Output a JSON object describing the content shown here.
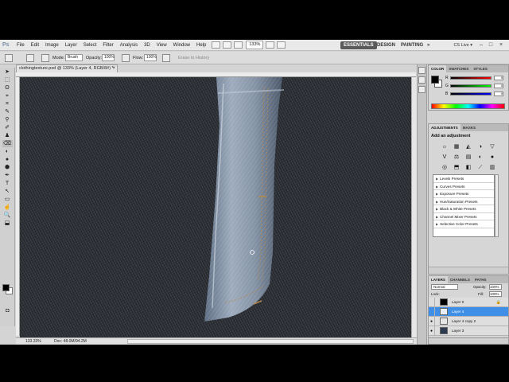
{
  "menubar": {
    "logo": "Ps",
    "items": [
      "File",
      "Edit",
      "Image",
      "Layer",
      "Select",
      "Filter",
      "Analysis",
      "3D",
      "View",
      "Window",
      "Help"
    ],
    "zoom": "133%",
    "workspaces": {
      "active": "ESSENTIALS",
      "others": [
        "DESIGN",
        "PAINTING"
      ],
      "more": "»"
    },
    "cslive": "CS Live ▾",
    "window_controls": [
      "–",
      "□",
      "×"
    ]
  },
  "options": {
    "mode_label": "Mode:",
    "mode_value": "Brush",
    "opacity_label": "Opacity:",
    "opacity_value": "100%",
    "flow_label": "Flow:",
    "flow_value": "100%",
    "erase_history": "Erase to History"
  },
  "document": {
    "tab_title": "clothingtexture.psd @ 133% (Layer 4, RGB/8#) *",
    "close": "×",
    "status_zoom": "133.33%",
    "status_doc": "Doc: 48.0M/94.2M"
  },
  "tools": {
    "glyphs": [
      "➤",
      "⬚",
      "ʘ",
      "⌖",
      "⌗",
      "✎",
      "⚲",
      "✐",
      "♟",
      "⌫",
      "◐",
      "●",
      "⬢",
      "✒",
      "T",
      "↖",
      "▭",
      "☝",
      "🔍",
      "⬓"
    ]
  },
  "color_panel": {
    "tabs": [
      "COLOR",
      "SWATCHES",
      "STYLES"
    ],
    "sliders": [
      {
        "label": "R",
        "value": "0"
      },
      {
        "label": "G",
        "value": "0"
      },
      {
        "label": "B",
        "value": "0"
      }
    ]
  },
  "adjustments": {
    "tabs": [
      "ADJUSTMENTS",
      "MASKS"
    ],
    "title": "Add an adjustment",
    "icons": [
      "☼",
      "▦",
      "◭",
      "◑",
      "▽",
      "V",
      "⚖",
      "▤",
      "◐",
      "●",
      "◎",
      "⬒",
      "◧",
      "⟋",
      "▥"
    ],
    "presets": [
      "Levels Presets",
      "Curves Presets",
      "Exposure Presets",
      "Hue/Saturation Presets",
      "Black & White Presets",
      "Channel Mixer Presets",
      "Selective Color Presets"
    ]
  },
  "layers": {
    "tabs": [
      "LAYERS",
      "CHANNELS",
      "PATHS"
    ],
    "blend_mode": "Normal",
    "opacity_label": "Opacity:",
    "opacity": "100%",
    "lock_label": "Lock:",
    "fill_label": "Fill:",
    "fill": "100%",
    "items": [
      {
        "name": "Layer 0"
      },
      {
        "name": "Layer 4"
      },
      {
        "name": "Layer 4 copy 2"
      },
      {
        "name": "Layer 3"
      }
    ]
  },
  "colors": {
    "selection": "#3f8fe6",
    "canvas_denim": "#2e3238",
    "pocket_denim": "#8897aa",
    "stitch": "#b58a4a"
  }
}
